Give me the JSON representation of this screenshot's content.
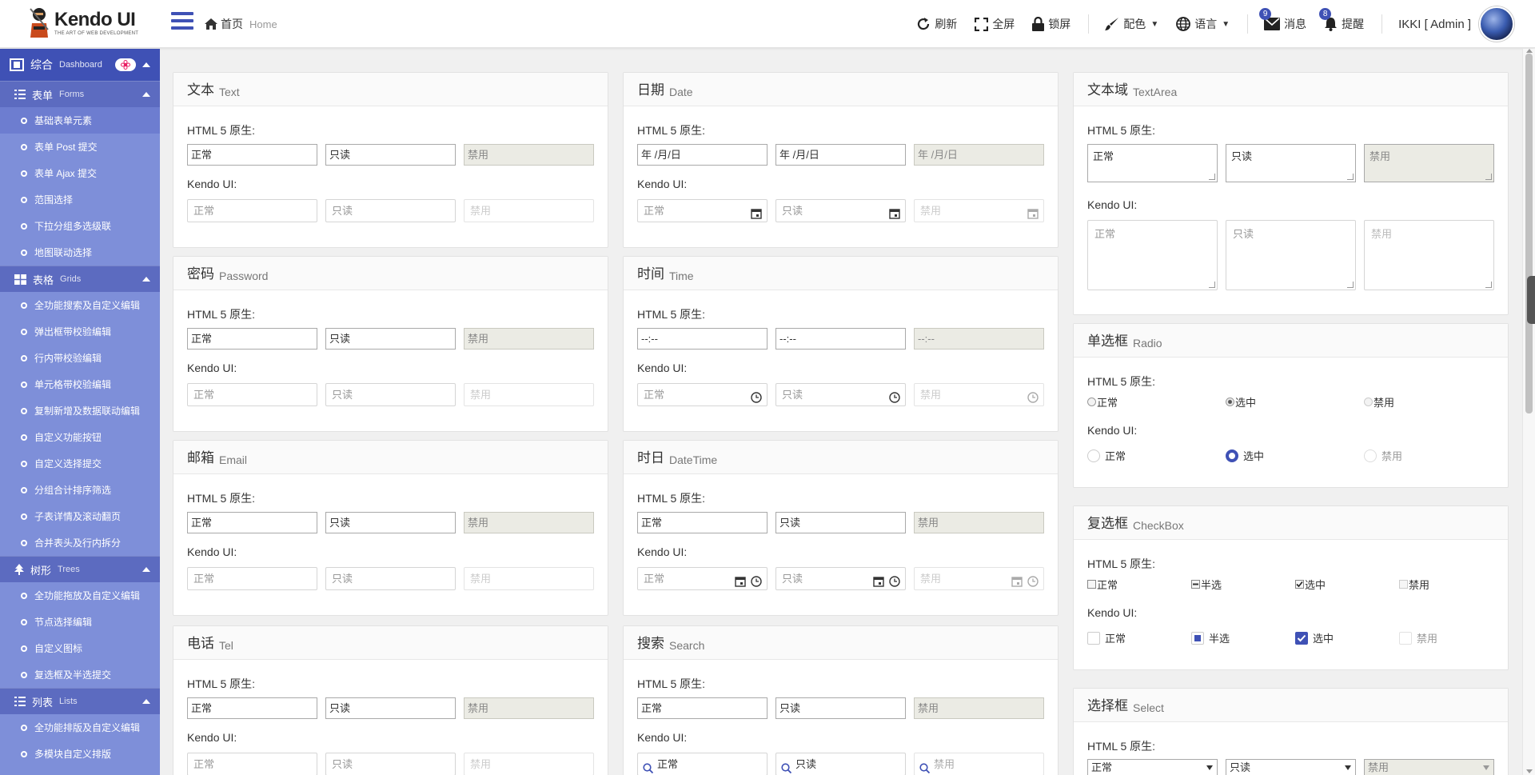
{
  "header": {
    "logo_title": "Kendo UI",
    "logo_sub": "THE ART OF WEB DEVELOPMENT",
    "crumb_home": "首页",
    "crumb_home_en": "Home",
    "tools": {
      "refresh": "刷新",
      "fullscreen": "全屏",
      "lock": "锁屏",
      "theme": "配色",
      "language": "语言",
      "messages": "消息",
      "messages_count": "9",
      "reminders": "提醒",
      "reminders_count": "8"
    },
    "user": "IKKI [ Admin ]"
  },
  "sidebar": {
    "dashboard": {
      "label": "综合",
      "en": "Dashboard"
    },
    "forms": {
      "label": "表单",
      "en": "Forms",
      "items": [
        "基础表单元素",
        "表单 Post 提交",
        "表单 Ajax 提交",
        "范围选择",
        "下拉分组多选级联",
        "地图联动选择"
      ]
    },
    "grids": {
      "label": "表格",
      "en": "Grids",
      "items": [
        "全功能搜索及自定义编辑",
        "弹出框带校验编辑",
        "行内带校验编辑",
        "单元格带校验编辑",
        "复制新增及数据联动编辑",
        "自定义功能按钮",
        "自定义选择提交",
        "分组合计排序筛选",
        "子表详情及滚动翻页",
        "合并表头及行内拆分"
      ]
    },
    "trees": {
      "label": "树形",
      "en": "Trees",
      "items": [
        "全功能拖放及自定义编辑",
        "节点选择编辑",
        "自定义图标",
        "复选框及半选提交"
      ]
    },
    "lists": {
      "label": "列表",
      "en": "Lists",
      "items": [
        "全功能排版及自定义编辑",
        "多模块自定义排版"
      ]
    }
  },
  "common": {
    "html5": "HTML 5 原生:",
    "kendo": "Kendo UI:",
    "normal": "正常",
    "readonly": "只读",
    "disabled": "禁用",
    "half": "半选",
    "checked": "选中",
    "date_placeholder": "年 /月/日",
    "time_placeholder": "--:--"
  },
  "panels": {
    "text": {
      "title": "文本",
      "en": "Text"
    },
    "password": {
      "title": "密码",
      "en": "Password"
    },
    "email": {
      "title": "邮箱",
      "en": "Email"
    },
    "tel": {
      "title": "电话",
      "en": "Tel"
    },
    "date": {
      "title": "日期",
      "en": "Date"
    },
    "time": {
      "title": "时间",
      "en": "Time"
    },
    "datetime": {
      "title": "时日",
      "en": "DateTime"
    },
    "search": {
      "title": "搜索",
      "en": "Search"
    },
    "textarea": {
      "title": "文本域",
      "en": "TextArea"
    },
    "radio": {
      "title": "单选框",
      "en": "Radio"
    },
    "checkbox": {
      "title": "复选框",
      "en": "CheckBox"
    },
    "select": {
      "title": "选择框",
      "en": "Select"
    }
  },
  "colors": {
    "primary": "#3f51b5",
    "sidebar": "#7e8fd9",
    "sidebar_section": "#5c6bc0"
  }
}
